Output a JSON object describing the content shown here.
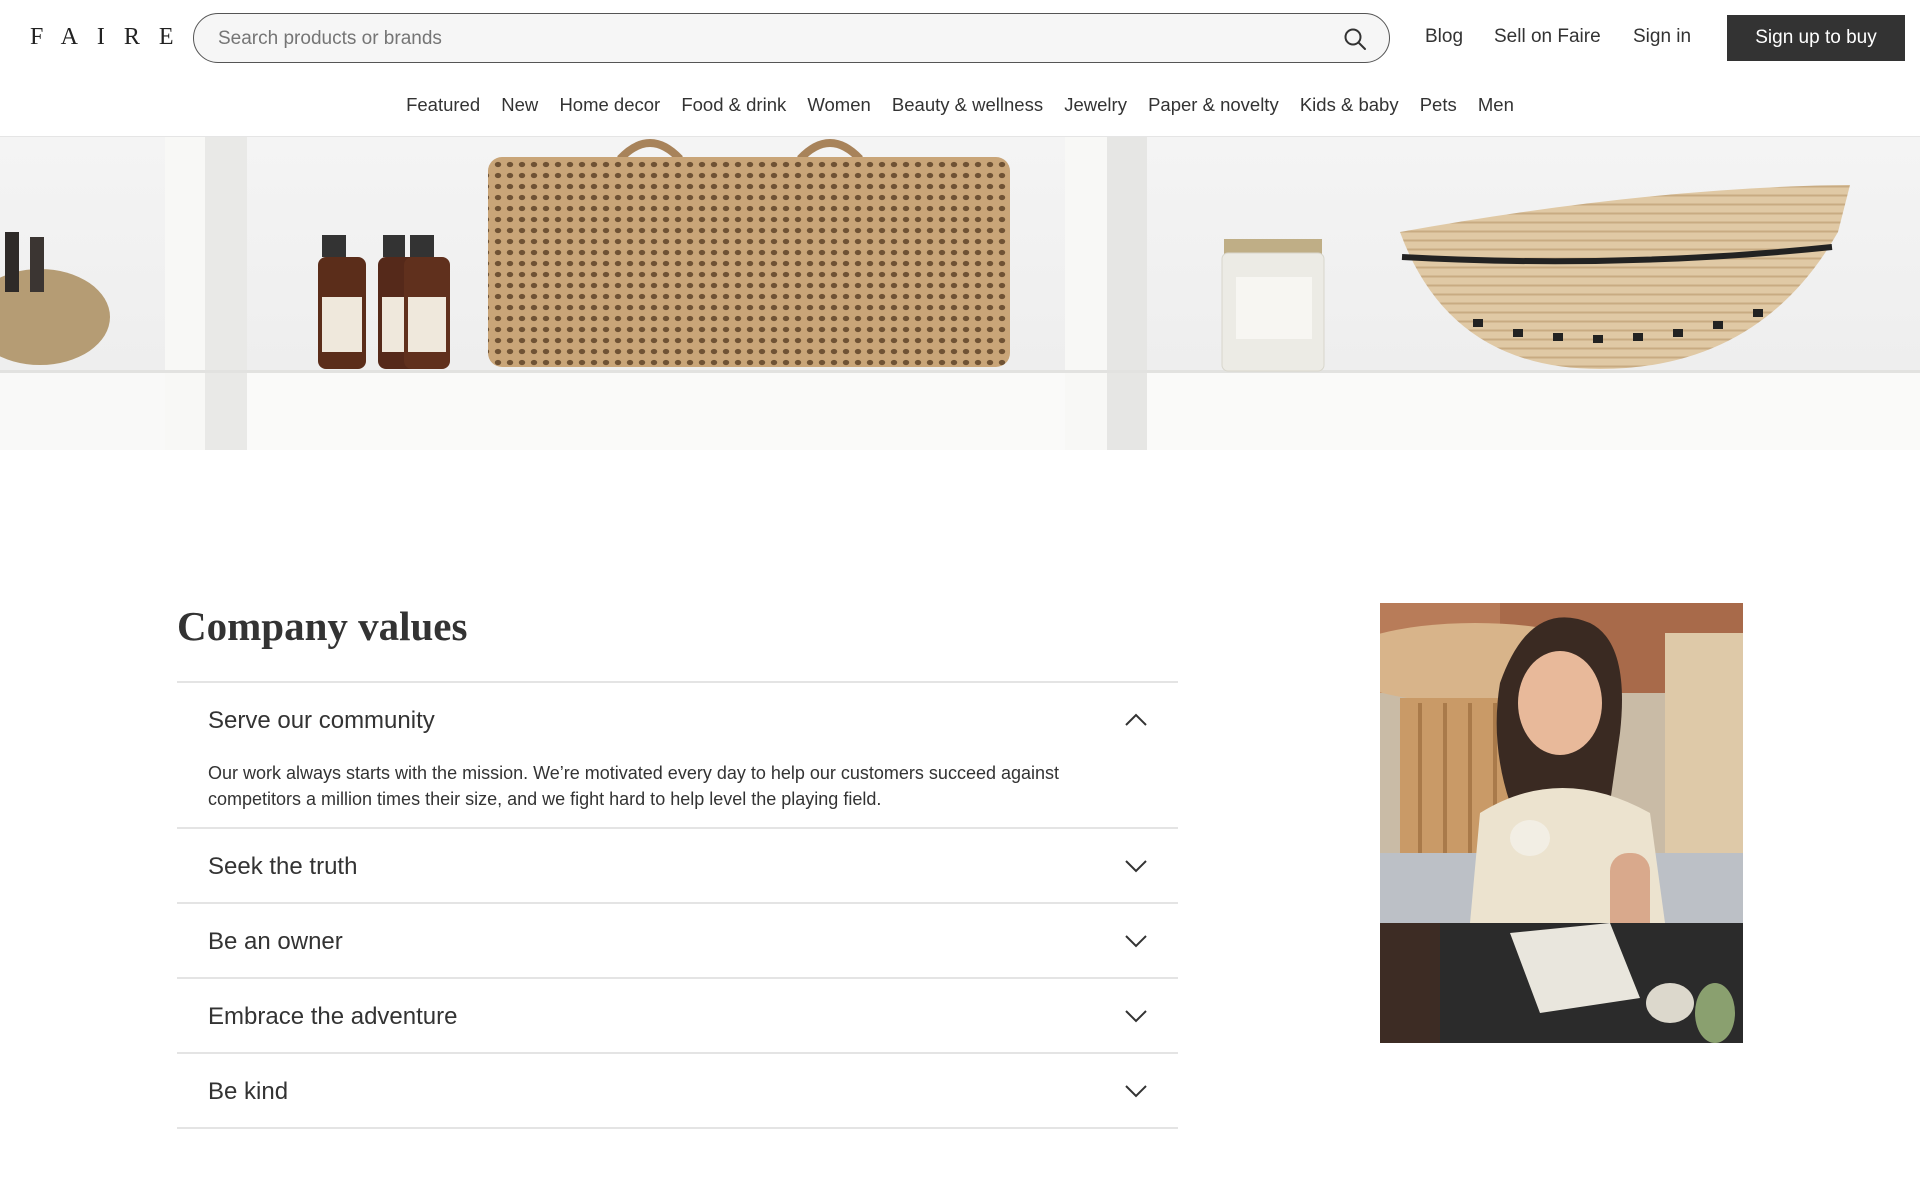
{
  "brand": {
    "logo": "FAIRE"
  },
  "search": {
    "placeholder": "Search products or brands"
  },
  "header_links": {
    "blog": "Blog",
    "sell": "Sell on Faire",
    "signin": "Sign in",
    "cta": "Sign up to buy"
  },
  "categories": [
    "Featured",
    "New",
    "Home decor",
    "Food & drink",
    "Women",
    "Beauty & wellness",
    "Jewelry",
    "Paper & novelty",
    "Kids & baby",
    "Pets",
    "Men"
  ],
  "values": {
    "title": "Company values",
    "items": [
      {
        "title": "Serve our community",
        "expanded": true,
        "body": "Our work always starts with the mission. We’re motivated every day to help our customers succeed against competitors a million times their size, and we fight hard to help level the playing field."
      },
      {
        "title": "Seek the truth",
        "expanded": false
      },
      {
        "title": "Be an owner",
        "expanded": false
      },
      {
        "title": "Embrace the adventure",
        "expanded": false
      },
      {
        "title": "Be kind",
        "expanded": false
      }
    ]
  },
  "colors": {
    "text": "#333333",
    "cta_bg": "#333333",
    "divider": "#e4e4e4"
  },
  "icons": {
    "search": "search-icon",
    "chevron_up": "chevron-up-icon",
    "chevron_down": "chevron-down-icon"
  }
}
